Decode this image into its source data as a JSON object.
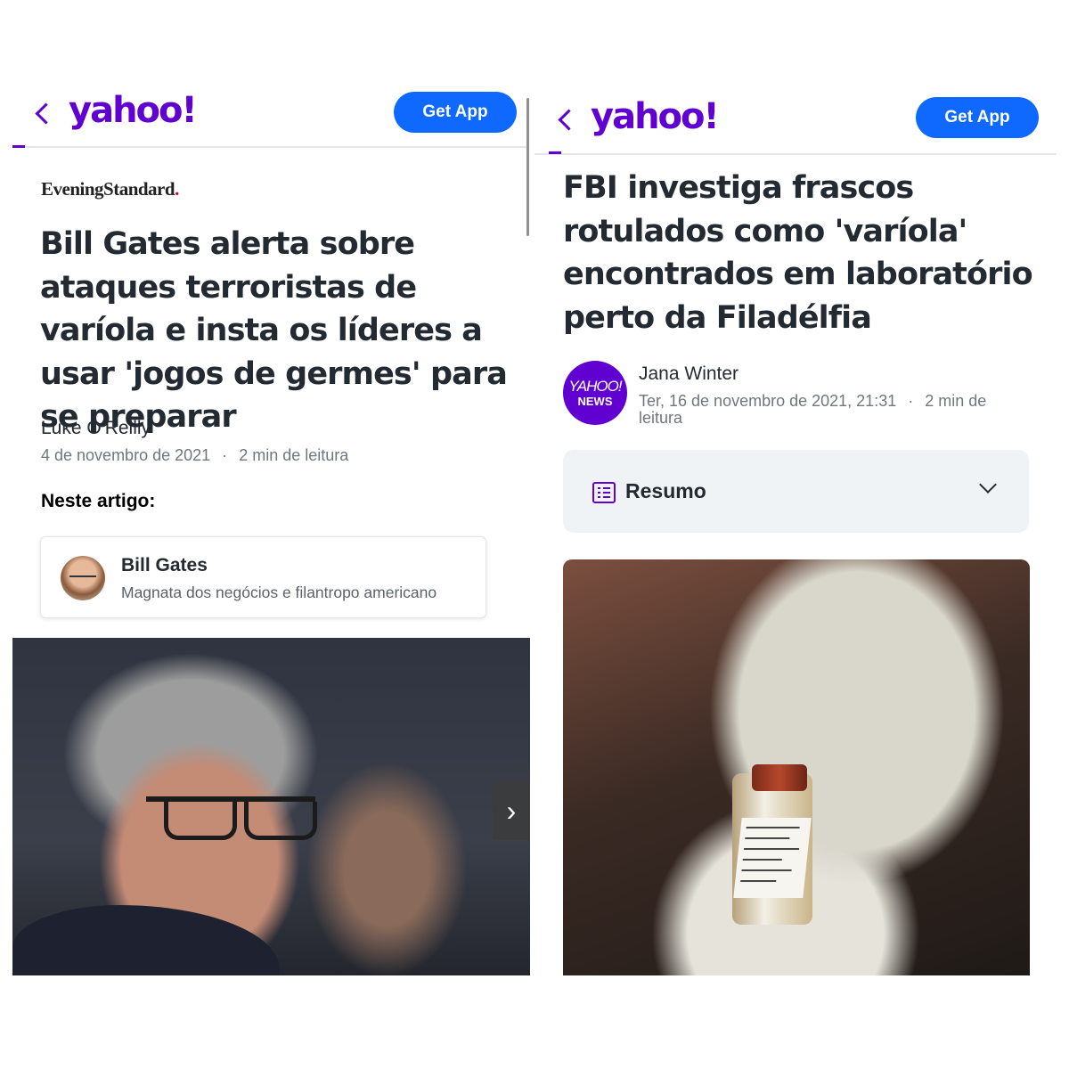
{
  "left": {
    "header": {
      "logo": "yahoo!",
      "get_app_label": "Get App"
    },
    "article": {
      "publisher_name": "EveningStandard",
      "publisher_dot": ".",
      "headline": "Bill Gates alerta sobre ataques terroristas de varíola e insta os líderes a usar 'jogos de germes' para se preparar",
      "author": "Luke O'Reilly",
      "date": "4 de novembro de 2021",
      "separator": "·",
      "read_time": "2 min de leitura",
      "in_this_article_label": "Neste artigo:",
      "entity": {
        "name": "Bill Gates",
        "description": "Magnata dos negócios e filantropo americano"
      },
      "carousel_next_glyph": "›"
    }
  },
  "right": {
    "header": {
      "logo": "yahoo!",
      "get_app_label": "Get App"
    },
    "article": {
      "headline": "FBI investiga frascos rotulados como 'varíola' encontrados em laboratório perto da Filadélfia",
      "source_avatar_line1": "YAHOO!",
      "source_avatar_line2": "NEWS",
      "author": "Jana Winter",
      "datetime": "Ter, 16 de novembro de 2021, 21:31",
      "separator": "·",
      "read_time": "2 min de leitura",
      "summary_label": "Resumo"
    }
  },
  "colors": {
    "brand_purple": "#6001d2",
    "get_app_blue": "#0f69ff",
    "text_primary": "#232a31",
    "text_secondary": "#6e7780"
  }
}
